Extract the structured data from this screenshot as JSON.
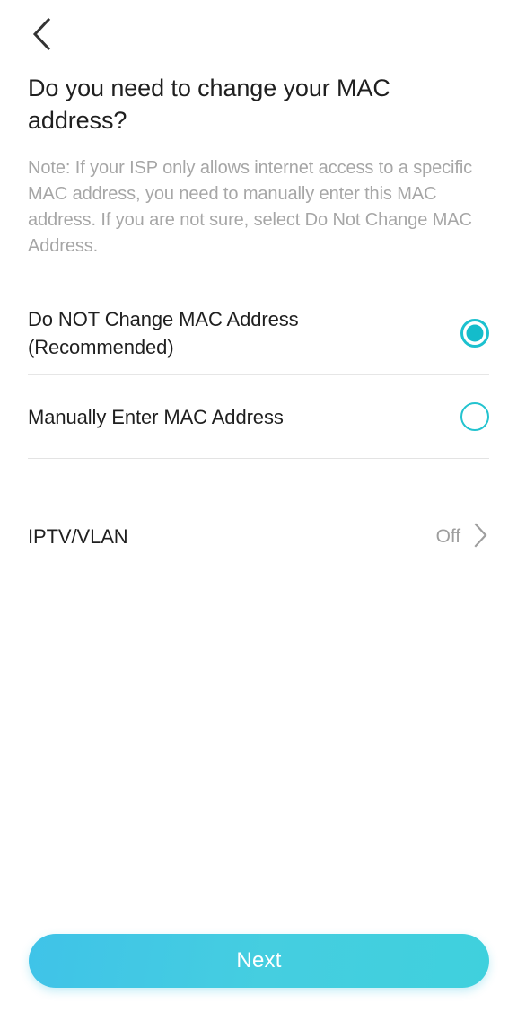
{
  "navbar": {
    "back_icon": "chevron-left-icon"
  },
  "header": {
    "title": "Do you need to change your MAC address?",
    "note": "Note: If your ISP only allows internet access to a specific MAC address, you need to manually enter this MAC address. If you are not sure, select Do Not Change MAC Address."
  },
  "options": {
    "items": [
      {
        "label": "Do NOT Change MAC Address (Recommended)",
        "selected": true,
        "control": "radio-button"
      },
      {
        "label": "Manually Enter MAC Address",
        "selected": false,
        "control": "radio-button"
      }
    ]
  },
  "settings_row": {
    "label": "IPTV/VLAN",
    "value": "Off",
    "chevron_icon": "chevron-right-icon"
  },
  "footer": {
    "next_label": "Next"
  },
  "colors": {
    "accent": "#14bccb",
    "button_gradient_start": "#3fc3e8",
    "button_gradient_end": "#3fd0dd",
    "title_text": "#1f1f1f",
    "note_text": "#a6a6a6",
    "value_text": "#9e9e9e",
    "divider": "#e6e6e6",
    "background": "#ffffff"
  }
}
